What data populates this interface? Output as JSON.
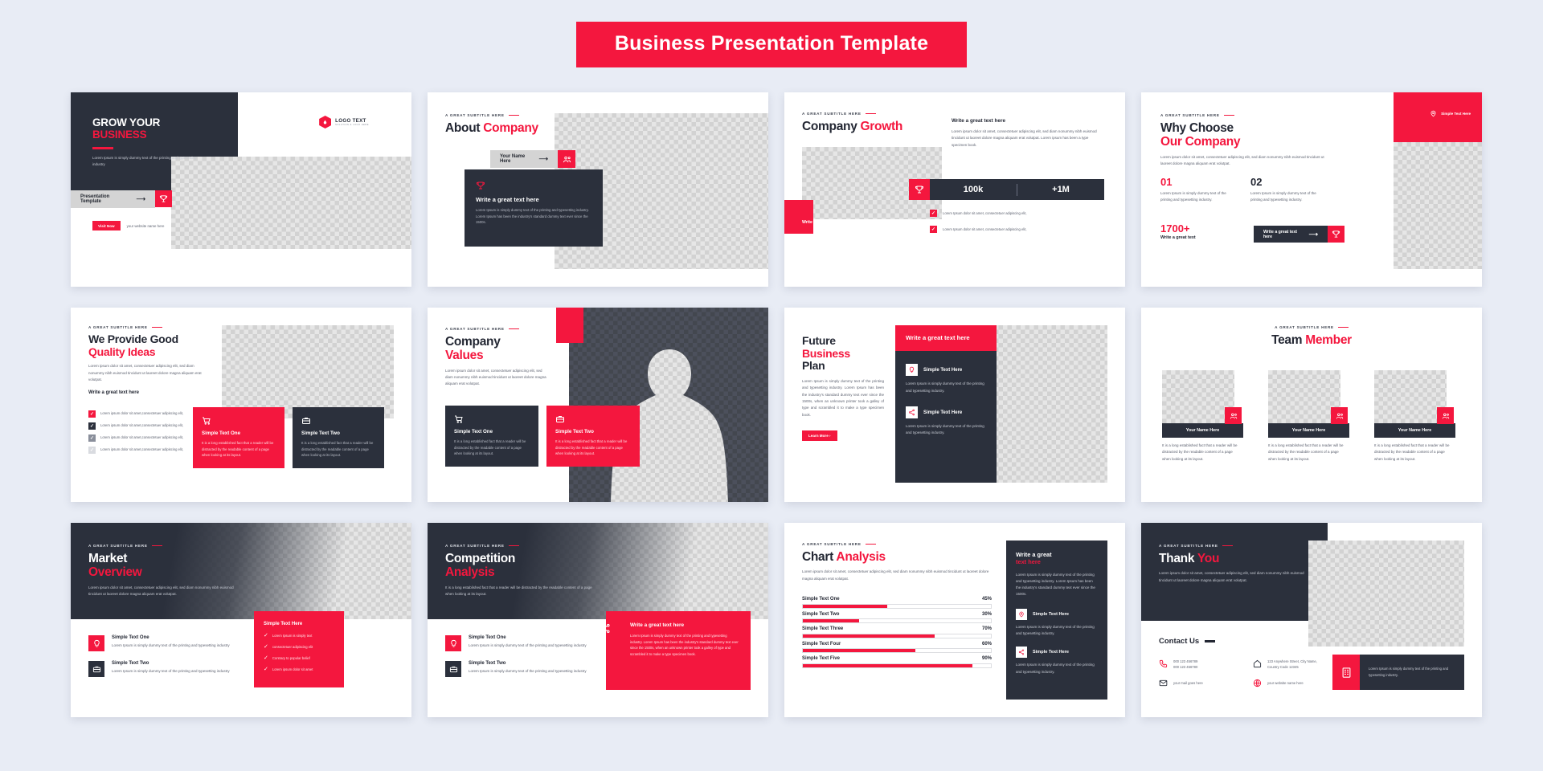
{
  "banner": {
    "title": "Business Presentation Template"
  },
  "common": {
    "eyebrow": "A GREAT SUBTITLE HERE",
    "lorem_short": "Lorem Ipsum is simply dummy text of the printing and typesetting industry",
    "lorem_medium": "Lorem ipsum dolor sit amet, consectetuer adipiscing elit, sed diam nonummy nibh euismod tincidunt ut laoreet dolore magna aliquam erat volutpat.",
    "lorem_card": "It is a long established fact that a reader will be distracted by the readable content of a page when looking at its layout.",
    "lorem_list": "Lorem ipsum dolor sit amet,consectetuer adipiscing elit,",
    "lorem_check": "Lorem Ipsum dolor sit amet, consectetuer adipiscing elit,",
    "lorem_icon": "Lorem Ipsum is simply dummy text of the printing and typesetting industry.",
    "write_great_text": "Write a great text here",
    "simple_text_here": "Simple Text Here",
    "simple_text_one": "Simple Text One",
    "simple_text_two": "Simple Text Two"
  },
  "slides": [
    {
      "id": "grow-your-business",
      "title_line1": "GROW YOUR",
      "title_line2": "BUSINESS",
      "desc": "Lorem Ipsum is simply dummy text of the printing and typesetting industry",
      "logo_text": "LOGO TEXT",
      "logo_sub": "SOLUTION & LOGO HERE",
      "cta_label": "Presentation Template",
      "visit_label": "Visit Now",
      "website_label": "your website name here",
      "trophy_icon": "trophy-icon"
    },
    {
      "id": "about-company",
      "title_dark": "About",
      "title_red": "Company",
      "name_button": "Your Name Here",
      "card_title": "Write a great text here",
      "card_body": "Lorem Ipsum is simply dummy text of the printing and typesetting industry. Lorem Ipsum has been the industry's standard dummy text ever since the 1500s.",
      "people_icon": "people-icon",
      "trophy_icon": "trophy-icon"
    },
    {
      "id": "company-growth",
      "title_dark": "Company",
      "title_red": "Growth",
      "right_title": "Write a great text here",
      "right_body": "Lorem ipsum dolor sit amet, consectetuer adipiscing elit, sed diam nonummy nibh euismod tincidunt ut laoreet dolore magna aliquam erat volutpat. Lorem ipsum has been a type specimen book.",
      "stat_one": "100k",
      "stat_two": "+1M",
      "cta_label": "Write a great text here",
      "checks": [
        "Lorem Ipsum dolor sit amet, consectetuer adipiscing elit,",
        "Lorem Ipsum dolor sit amet, consectetuer adipiscing elit,"
      ],
      "trophy_icon": "trophy-icon"
    },
    {
      "id": "why-choose-our-company",
      "title_dark": "Why Choose",
      "title_red": "Our Company",
      "desc": "Lorem ipsum dolor sit amet, consectetuer adipiscing elit, sed diam nonummy nibh euismod tincidunt ut laoreet dolore magna aliquam erat volutpat.",
      "badge_label": "Simple Text Here",
      "num_one": "01",
      "num_two": "02",
      "num_one_body": "Lorem Ipsum is simply dummy text of the printing and typesetting industry.",
      "num_two_body": "Lorem Ipsum is simply dummy text of the printing and typesetting industry.",
      "big_number": "1700+",
      "big_number_caption": "Write a great text",
      "cta_label": "Write a great text here",
      "pin_icon": "location-pin-icon",
      "trophy_icon": "trophy-icon"
    },
    {
      "id": "we-provide-good-quality-ideas",
      "title_dark": "We Provide Good",
      "title_red": "Quality Ideas",
      "desc": "Lorem ipsum dolor sit amet, consectetuer adipiscing elit, sed diam nonummy nibh euismod tincidunt ut laoreet dolore magna aliquam erat volutpat.",
      "list_heading": "Write a great text here",
      "list_items": [
        "Lorem ipsum dolor sit amet,consectetuer adipiscing elit,",
        "Lorem ipsum dolor sit amet,consectetuer adipiscing elit,",
        "Lorem ipsum dolor sit amet,consectetuer adipiscing elit,",
        "Lorem ipsum dolor sit amet,consectetuer adipiscing elit,"
      ],
      "card_one_title": "Simple Text One",
      "card_two_title": "Simple Text Two",
      "card_body": "It is a long established fact that a reader will be distracted by the readable content of a page when looking at its layout.",
      "cart_icon": "shopping-cart-icon",
      "briefcase_icon": "briefcase-icon"
    },
    {
      "id": "company-values",
      "title_dark": "Company",
      "title_red": "Values",
      "desc": "Lorem ipsum dolor sit amet, consectetuer adipiscing elit, sed diam nonummy nibh euismod tincidunt ut laoreet dolore magna aliquam erat volutpat.",
      "card_one_title": "Simple Text One",
      "card_two_title": "Simple Text Two",
      "card_body": "It is a long established fact that a reader will be distracted by the readable content of a page when looking at its layout.",
      "cart_icon": "shopping-cart-icon",
      "briefcase_icon": "briefcase-icon"
    },
    {
      "id": "future-business-plan",
      "title_line1": "Future",
      "title_line2": "Business",
      "title_line3": "Plan",
      "desc": "Lorem Ipsum is simply dummy text of the printing and typesetting industry. Lorem Ipsum has been the industry's standard dummy text ever since the 1500s, when an unknown printer took a galley of type and scrambled it to make a type specimen book.",
      "learn_more": "Learn More",
      "panel_title": "Write a great text here",
      "item_one_title": "Simple Text Here",
      "item_one_body": "Lorem Ipsum is simply dummy text of the printing and typesetting industry.",
      "item_two_title": "Simple Text Here",
      "item_two_body": "Lorem Ipsum is simply dummy text of the printing and typesetting industry.",
      "bulb_icon": "lightbulb-icon",
      "share_icon": "share-icon"
    },
    {
      "id": "team-member",
      "title_dark": "Team",
      "title_red": "Member",
      "members": [
        {
          "name": "Your Name Here",
          "bio": "It is a long established fact that a reader will be distracted by the readable content of a page when looking at its layout."
        },
        {
          "name": "Your Name Here",
          "bio": "It is a long established fact that a reader will be distracted by the readable content of a page when looking at its layout."
        },
        {
          "name": "Your Name Here",
          "bio": "It is a long established fact that a reader will be distracted by the readable content of a page when looking at its layout."
        }
      ],
      "people_icon": "people-icon"
    },
    {
      "id": "market-overview",
      "title_dark": "Market",
      "title_red": "Overview",
      "desc": "Lorem ipsum dolor sit amet, consectetuer adipiscing elit, sed diam nonummy nibh euismod tincidunt ut laoreet dolore magna aliquam erat volutpat.",
      "item_one_title": "Simple Text One",
      "item_one_body": "Lorem Ipsum is simply dummy text of the printing and typesetting industry",
      "item_two_title": "Simple Text Two",
      "item_two_body": "Lorem Ipsum is simply dummy text of the printing and typesetting industry",
      "panel_title": "Simple Text Here",
      "panel_items": [
        "Lorem Ipsum is simply text",
        "consectetuer adipiscing elit",
        "Contrary to popular belief",
        "Lorem ipsum dolor sit amet"
      ],
      "bulb_icon": "lightbulb-icon",
      "briefcase_icon": "briefcase-icon"
    },
    {
      "id": "competition-analysis",
      "title_dark": "Competition",
      "title_red": "Analysis",
      "desc": "It is a long established fact that a reader will be distracted by the readable content of a page when looking at its layout.",
      "item_one_title": "Simple Text One",
      "item_one_body": "Lorem Ipsum is simply dummy text of the printing and typesetting industry",
      "item_two_title": "Simple Text Two",
      "item_two_body": "Lorem Ipsum is simply dummy text of the printing and typesetting industry",
      "panel_title": "Write a great text here",
      "panel_body": "Lorem Ipsum is simply dummy text of the printing and typesetting industry. Lorem Ipsum has been the industry's standard dummy text ever since the 1500s, when an unknown printer took a galley of type and scrambled it to make a type specimen book.",
      "bulb_icon": "lightbulb-icon",
      "briefcase_icon": "briefcase-icon",
      "share_icon": "share-icon"
    },
    {
      "id": "chart-analysis",
      "title_dark": "Chart",
      "title_red": "Analysis",
      "desc": "Lorem ipsum dolor sit amet, consectetuer adipiscing elit, sed diam nonummy nibh euismod tincidunt ut laoreet dolore magna aliquam erat volutpat.",
      "panel_title_line1": "Write a great",
      "panel_title_line2": "text here",
      "panel_body": "Lorem Ipsum is simply dummy text of the printing and typesetting industry. Lorem Ipsum has been the industry's standard dummy text ever since the 1500s.",
      "item_one_title": "Simple Text Here",
      "item_one_body": "Lorem Ipsum is simply dummy text of the printing and typesetting industry.",
      "item_two_title": "Simple Text Here",
      "item_two_body": "Lorem Ipsum is simply dummy text of the printing and typesetting industry.",
      "pin_icon": "location-pin-icon",
      "share_icon": "share-icon"
    },
    {
      "id": "thank-you",
      "title_dark": "Thank",
      "title_red": "You",
      "desc": "Lorem ipsum dolor sit amet, consectetuer adipiscing elit, sed diam nonummy nibh euismod tincidunt ut laoreet dolore magna aliquam erat volutpat.",
      "contact_heading": "Contact Us",
      "phone_1": "000 123 456789",
      "phone_2": "000 123 456780",
      "address_1": "123 Anywhere Street, City Name,",
      "address_2": "Country Code 12345",
      "email": "your mail goes here",
      "website": "your website name here",
      "card_body": "Lorem Ipsum is simply dummy text of the printing and typesetting industry.",
      "phone_icon": "phone-icon",
      "home_icon": "home-icon",
      "mail_icon": "mail-icon",
      "globe_icon": "globe-icon",
      "building_icon": "building-icon"
    }
  ],
  "chart_data": {
    "type": "bar",
    "orientation": "horizontal",
    "title": "Chart Analysis",
    "categories": [
      "Simple Text One",
      "Simple Text Two",
      "Simple Text Three",
      "Simple Text Four",
      "Simple Text Five"
    ],
    "values": [
      45,
      30,
      70,
      60,
      90
    ],
    "value_labels": [
      "45%",
      "30%",
      "70%",
      "60%",
      "90%"
    ],
    "xlabel": "",
    "ylabel": "",
    "xlim": [
      0,
      100
    ],
    "grid": false,
    "legend": "none",
    "bar_color": "#f4173e",
    "track_color": "#ffffff"
  },
  "colors": {
    "accent_red": "#f4173e",
    "dark": "#2b303c",
    "page_bg": "#e8ecf5",
    "slide_bg": "#ffffff",
    "grey_button": "#d4d4d4"
  }
}
